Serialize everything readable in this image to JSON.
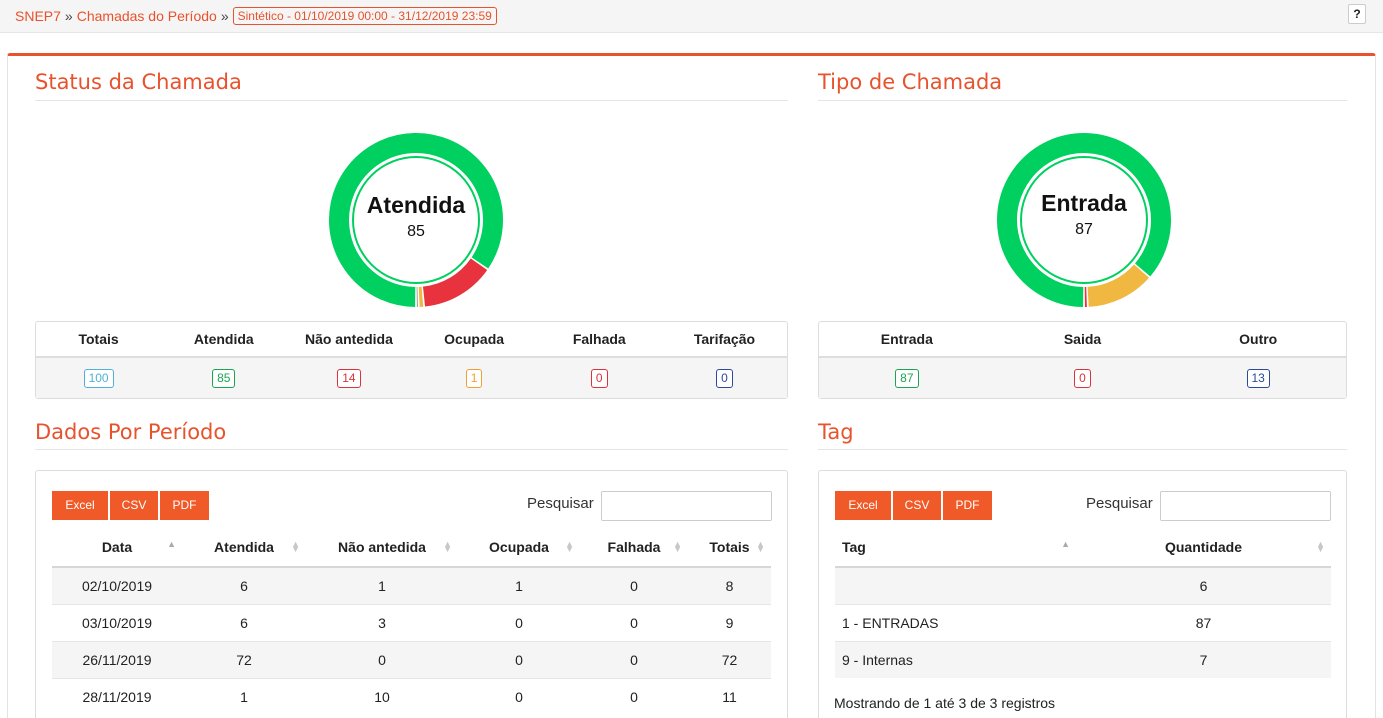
{
  "breadcrumb": {
    "root": "SNEP7",
    "sep1": "»",
    "page": "Chamadas do Período",
    "sep2": "»",
    "period": "Sintético - 01/10/2019 00:00 - 31/12/2019 23:59"
  },
  "help_label": "?",
  "status_section": {
    "title": "Status da Chamada",
    "donut": {
      "label": "Atendida",
      "value": "85",
      "slices": [
        {
          "name": "Atendida",
          "value": 85,
          "color": "#00d060"
        },
        {
          "name": "Não antedida",
          "value": 14,
          "color": "#e8323d"
        },
        {
          "name": "Ocupada",
          "value": 1,
          "color": "#f0b840"
        },
        {
          "name": "Falhada",
          "value": 0.5,
          "color": "#888888"
        }
      ]
    },
    "headers": [
      "Totais",
      "Atendida",
      "Não antedida",
      "Ocupada",
      "Falhada",
      "Tarifação"
    ],
    "values": [
      "100",
      "85",
      "14",
      "1",
      "0",
      "0"
    ],
    "value_colors": [
      "blue",
      "green",
      "red",
      "orange",
      "red",
      "navy"
    ]
  },
  "type_section": {
    "title": "Tipo de Chamada",
    "donut": {
      "label": "Entrada",
      "value": "87",
      "slices": [
        {
          "name": "Entrada",
          "value": 87,
          "color": "#00d060"
        },
        {
          "name": "Outro",
          "value": 13,
          "color": "#f0b840"
        },
        {
          "name": "Saida",
          "value": 0.7,
          "color": "#e8323d"
        }
      ]
    },
    "headers": [
      "Entrada",
      "Saida",
      "Outro"
    ],
    "values": [
      "87",
      "0",
      "13"
    ],
    "value_colors": [
      "green",
      "red",
      "navy"
    ]
  },
  "period_section": {
    "title": "Dados Por Período",
    "buttons": [
      "Excel",
      "CSV",
      "PDF"
    ],
    "search_label": "Pesquisar",
    "search_value": "",
    "columns": [
      "Data",
      "Atendida",
      "Não antedida",
      "Ocupada",
      "Falhada",
      "Totais"
    ],
    "rows": [
      [
        "02/10/2019",
        "6",
        "1",
        "1",
        "0",
        "8"
      ],
      [
        "03/10/2019",
        "6",
        "3",
        "0",
        "0",
        "9"
      ],
      [
        "26/11/2019",
        "72",
        "0",
        "0",
        "0",
        "72"
      ],
      [
        "28/11/2019",
        "1",
        "10",
        "0",
        "0",
        "11"
      ]
    ]
  },
  "tag_section": {
    "title": "Tag",
    "buttons": [
      "Excel",
      "CSV",
      "PDF"
    ],
    "search_label": "Pesquisar",
    "search_value": "",
    "columns": [
      "Tag",
      "Quantidade"
    ],
    "rows": [
      [
        "",
        "6"
      ],
      [
        "1 - ENTRADAS",
        "87"
      ],
      [
        "9 - Internas",
        "7"
      ]
    ],
    "info": "Mostrando de 1 até 3 de 3 registros"
  }
}
